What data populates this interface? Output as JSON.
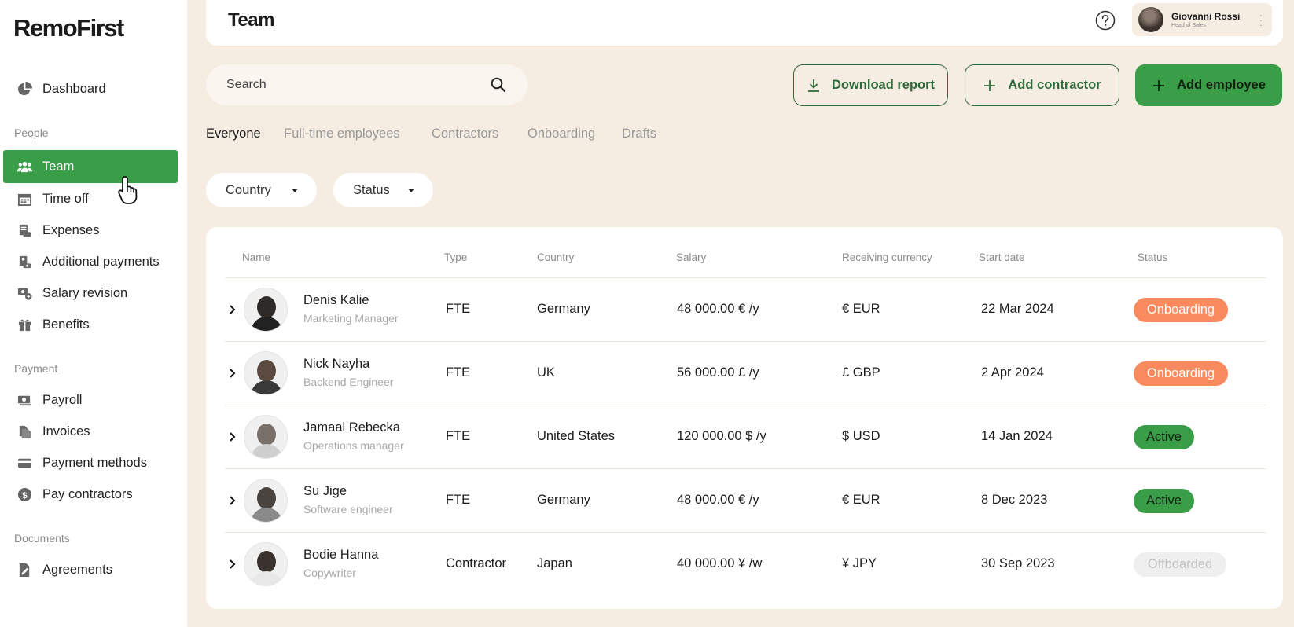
{
  "sidebar": {
    "logo": "RemoFirst",
    "dashboard": "Dashboard",
    "sections": {
      "people": "People",
      "payment": "Payment",
      "documents": "Documents"
    },
    "items": {
      "team": "Team",
      "time_off": "Time off",
      "expenses": "Expenses",
      "additional_payments": "Additional payments",
      "salary_revision": "Salary revision",
      "benefits": "Benefits",
      "payroll": "Payroll",
      "invoices": "Invoices",
      "payment_methods": "Payment methods",
      "pay_contractors": "Pay contractors",
      "agreements": "Agreements"
    },
    "active_item": "Team"
  },
  "header": {
    "title": "Team",
    "user": {
      "name": "Giovanni Rossi",
      "role": "Head of Sales"
    }
  },
  "search": {
    "placeholder": "Search"
  },
  "actions": {
    "download_report": "Download report",
    "add_contractor": "Add contractor",
    "add_employee": "Add employee"
  },
  "tabs": {
    "everyone": "Everyone",
    "full_time": "Full-time employees",
    "contractors": "Contractors",
    "onboarding": "Onboarding",
    "drafts": "Drafts"
  },
  "active_tab": "Everyone",
  "filters": {
    "country": "Country",
    "status": "Status"
  },
  "table": {
    "columns": {
      "name": "Name",
      "type": "Type",
      "country": "Country",
      "salary": "Salary",
      "currency": "Receiving currency",
      "start_date": "Start date",
      "status": "Status"
    },
    "rows": [
      {
        "name": "Denis Kalie",
        "role": "Marketing Manager",
        "type": "FTE",
        "country": "Germany",
        "salary": "48 000.00 € /y",
        "currency": "€ EUR",
        "start": "22 Mar 2024",
        "status": "Onboarding"
      },
      {
        "name": "Nick Nayha",
        "role": "Backend Engineer",
        "type": "FTE",
        "country": "UK",
        "salary": "56 000.00 £ /y",
        "currency": "£ GBP",
        "start": "2 Apr 2024",
        "status": "Onboarding"
      },
      {
        "name": "Jamaal Rebecka",
        "role": "Operations manager",
        "type": "FTE",
        "country": "United States",
        "salary": "120 000.00 $ /y",
        "currency": "$ USD",
        "start": "14 Jan 2024",
        "status": "Active"
      },
      {
        "name": "Su Jige",
        "role": "Software engineer",
        "type": "FTE",
        "country": "Germany",
        "salary": "48 000.00 € /y",
        "currency": "€ EUR",
        "start": "8 Dec 2023",
        "status": "Active"
      },
      {
        "name": "Bodie Hanna",
        "role": "Copywriter",
        "type": "Contractor",
        "country": "Japan",
        "salary": "40 000.00 ¥ /w",
        "currency": "¥ JPY",
        "start": "30 Sep 2023",
        "status": "Offboarded"
      }
    ]
  },
  "colors": {
    "accent_green": "#3a9d48",
    "onboarding_badge": "#f98a5e",
    "active_badge": "#3a9d48",
    "offboarded_badge": "#efefef",
    "page_background": "#f5ede2"
  }
}
